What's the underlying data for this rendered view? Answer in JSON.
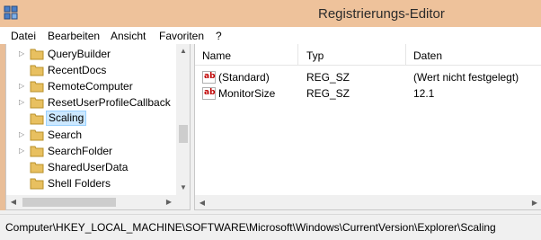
{
  "window": {
    "title": "Registrierungs-Editor",
    "frame_color": "#eec29b"
  },
  "menu": {
    "items": [
      {
        "label": "Datei"
      },
      {
        "label": "Bearbeiten"
      },
      {
        "label": "Ansicht"
      },
      {
        "label": "Favoriten"
      },
      {
        "label": "?"
      }
    ]
  },
  "tree": {
    "items": [
      {
        "label": "QueryBuilder",
        "expander": "▷",
        "selected": false
      },
      {
        "label": "RecentDocs",
        "expander": "",
        "selected": false
      },
      {
        "label": "RemoteComputer",
        "expander": "▷",
        "selected": false
      },
      {
        "label": "ResetUserProfileCallback",
        "expander": "▷",
        "selected": false
      },
      {
        "label": "Scaling",
        "expander": "",
        "selected": true
      },
      {
        "label": "Search",
        "expander": "▷",
        "selected": false
      },
      {
        "label": "SearchFolder",
        "expander": "▷",
        "selected": false
      },
      {
        "label": "SharedUserData",
        "expander": "",
        "selected": false
      },
      {
        "label": "Shell Folders",
        "expander": "",
        "selected": false
      }
    ]
  },
  "list": {
    "columns": [
      {
        "label": "Name"
      },
      {
        "label": "Typ"
      },
      {
        "label": "Daten"
      }
    ],
    "rows": [
      {
        "icon": "ab",
        "name": "(Standard)",
        "type": "REG_SZ",
        "data": "(Wert nicht festgelegt)"
      },
      {
        "icon": "ab",
        "name": "MonitorSize",
        "type": "REG_SZ",
        "data": "12.1"
      }
    ]
  },
  "status": {
    "path": "Computer\\HKEY_LOCAL_MACHINE\\SOFTWARE\\Microsoft\\Windows\\CurrentVersion\\Explorer\\Scaling"
  },
  "colors": {
    "selection_bg": "#cce8ff",
    "selection_border": "#99d1ff",
    "folder": "#e8c060",
    "string_icon": "#c00000"
  },
  "icons": {
    "app": "registry-editor-icon",
    "folder": "folder-icon",
    "value": "string-value-icon"
  }
}
